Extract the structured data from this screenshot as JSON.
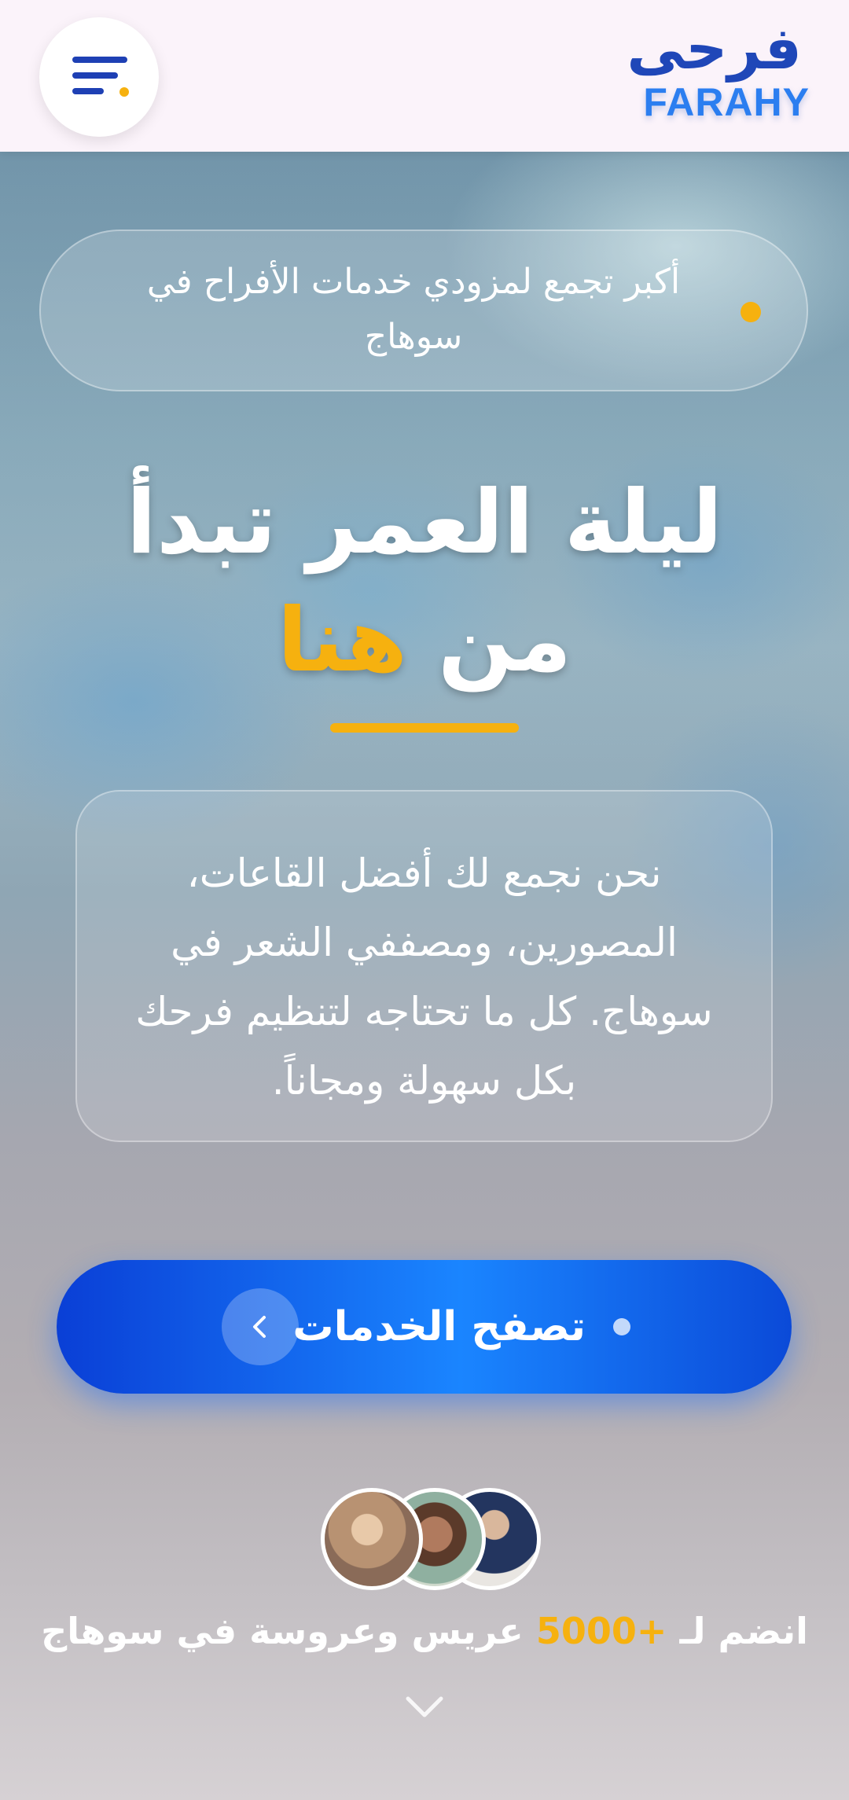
{
  "header": {
    "logo_ar": "فرحى",
    "logo_en": "FARAHY",
    "menu_icon": "menu-icon"
  },
  "hero": {
    "tagline": "أكبر تجمع لمزودي خدمات الأفراح في سوهاج",
    "headline_line1": "ليلة العمر تبدأ",
    "headline_line2_main": "من",
    "headline_line2_accent": "هنا",
    "description": "نحن نجمع لك أفضل القاعات، المصورين، ومصففي الشعر في سوهاج. كل ما تحتاجه لتنظيم فرحك بكل سهولة ومجاناً."
  },
  "cta": {
    "label": "تصفح الخدمات",
    "icon": "chevron-left-icon"
  },
  "social_proof": {
    "prefix": "انضم لـ",
    "count": "+5000",
    "suffix": "عريس وعروسة في سوهاج"
  },
  "colors": {
    "brand_dark": "#1f47b8",
    "brand_light": "#2b7ef0",
    "accent": "#f6b10f",
    "cta_blue": "#1a85ff"
  }
}
